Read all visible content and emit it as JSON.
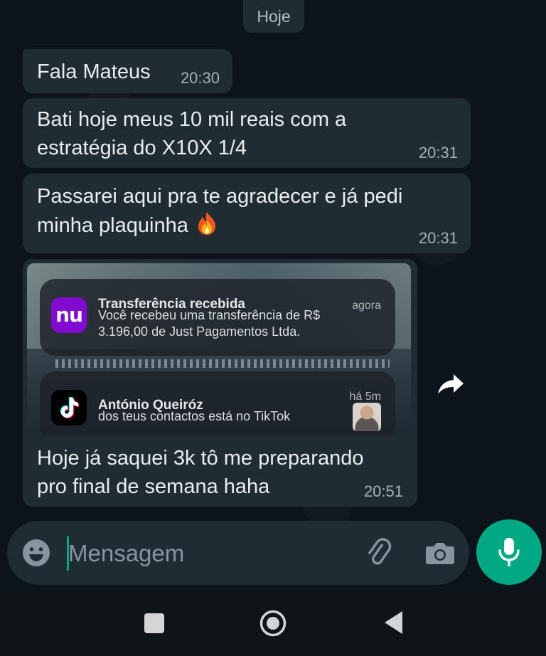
{
  "date_chip": "Hoje",
  "messages": [
    {
      "text": "Fala Mateus",
      "time": "20:30"
    },
    {
      "text": "Bati hoje meus 10 mil reais com a estratégia do X10X 1/4",
      "time": "20:31"
    },
    {
      "text": "Passarei aqui pra te agradecer e já pedi minha plaquinha",
      "emoji": "🔥",
      "time": "20:31"
    },
    {
      "text": "Hoje já saquei 3k tô me preparando pro final de semana haha",
      "time": "20:51"
    }
  ],
  "screenshot": {
    "notifications": [
      {
        "app_icon": "nu-logo",
        "app_icon_text": "nu",
        "title": "Transferência recebida",
        "body": "Você recebeu uma transferência de R$ 3.196,00 de Just Pagamentos Ltda.",
        "when": "agora"
      },
      {
        "app_icon": "tiktok-logo",
        "title": "António Queiróz",
        "body": "dos teus contactos está no TikTok",
        "when": "há 5m"
      }
    ]
  },
  "composer": {
    "placeholder": "Mensagem"
  },
  "colors": {
    "background": "#0b141a",
    "bubble": "#202c33",
    "accent": "#00a884",
    "nubank": "#820ad1"
  }
}
